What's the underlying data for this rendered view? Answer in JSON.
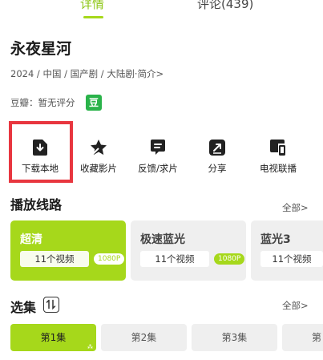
{
  "tabs": {
    "detail": "详情",
    "comments": "评论(439)"
  },
  "title": "永夜星河",
  "meta": "2024 / 中国 / 国产剧 / 大陆剧·简介>",
  "rating": {
    "label": "豆瓣：暂无评分",
    "badge": "豆"
  },
  "actions": [
    {
      "label": "下载本地",
      "icon": "download-icon"
    },
    {
      "label": "收藏影片",
      "icon": "star-icon"
    },
    {
      "label": "反馈/求片",
      "icon": "feedback-icon"
    },
    {
      "label": "分享",
      "icon": "share-icon"
    },
    {
      "label": "电视联播",
      "icon": "tv-cast-icon"
    }
  ],
  "lines": {
    "title": "播放线路",
    "see_all": "全部>",
    "items": [
      {
        "name": "超清",
        "count": "11个视频",
        "resolution": "1080P",
        "selected": true
      },
      {
        "name": "极速蓝光",
        "count": "11个视频",
        "resolution": "1080P",
        "selected": false
      },
      {
        "name": "蓝光3",
        "count": "11个视频",
        "resolution": "",
        "selected": false
      }
    ]
  },
  "episodes": {
    "title": "选集",
    "see_all": "全部>",
    "items": [
      {
        "label": "第1集",
        "selected": true
      },
      {
        "label": "第2集",
        "selected": false
      },
      {
        "label": "第3集",
        "selected": false
      },
      {
        "label": "第",
        "selected": false
      }
    ]
  },
  "colors": {
    "accent": "#a6d81b",
    "highlight_border": "#e8363f",
    "douban": "#2ab34a"
  }
}
